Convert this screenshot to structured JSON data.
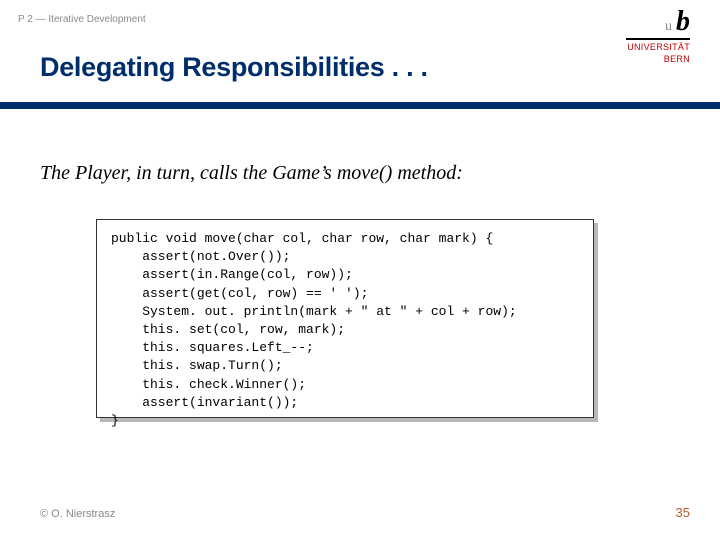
{
  "breadcrumb": "P 2 — Iterative Development",
  "logo": {
    "b": "b",
    "u": "u",
    "line1": "UNIVERSITÄT",
    "line2": "BERN"
  },
  "title": "Delegating Responsibilities . . .",
  "lead": "The Player, in turn, calls the Game’s move() method:",
  "code": "public void move(char col, char row, char mark) {\n    assert(not.Over());\n    assert(in.Range(col, row));\n    assert(get(col, row) == ' ');\n    System. out. println(mark + \" at \" + col + row);\n    this. set(col, row, mark);\n    this. squares.Left_--;\n    this. swap.Turn();\n    this. check.Winner();\n    assert(invariant());\n}",
  "footer": {
    "left": "© O. Nierstrasz",
    "right": "35"
  }
}
